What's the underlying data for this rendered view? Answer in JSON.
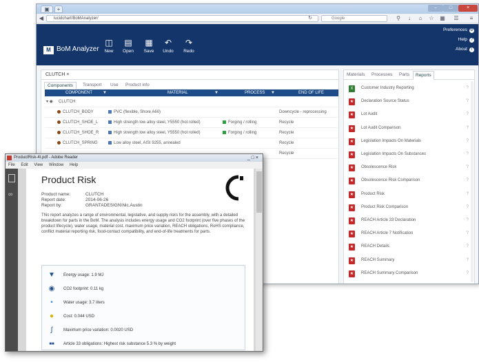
{
  "browser": {
    "url": "lucidchart/BoMAnalyzer/",
    "search_placeholder": "Google",
    "tab_new": "+"
  },
  "app": {
    "logo": "M",
    "name": "BoM Analyzer",
    "toolbar": [
      {
        "label": "New",
        "icon": "new-icon"
      },
      {
        "label": "Open",
        "icon": "open-icon"
      },
      {
        "label": "Save",
        "icon": "save-icon"
      },
      {
        "label": "Undo",
        "icon": "undo-icon"
      },
      {
        "label": "Redo",
        "icon": "redo-icon"
      }
    ],
    "right_links": {
      "preferences": "Preferences",
      "help": "Help",
      "about": "About"
    }
  },
  "left": {
    "doc_tab": "CLUTCH ×",
    "subtabs": [
      "Components",
      "Transport",
      "Use",
      "Product info"
    ],
    "columns": [
      "COMPONENT",
      "MATERIAL",
      "PROCESS",
      "END OF LIFE"
    ],
    "group": "CLUTCH",
    "rows": [
      {
        "component": "CLUTCH_BODY",
        "material": "PVC (flexible, Shore A60)",
        "process": "",
        "eol": "Downcycle - reprocessing"
      },
      {
        "component": "CLUTCH_SHOE_L",
        "material": "High strength low alloy steel, Y5550 (hot rolled)",
        "process": "Forging / rolling",
        "eol": "Recycle"
      },
      {
        "component": "CLUTCH_SHOE_R",
        "material": "High strength low alloy steel, Y5550 (hot rolled)",
        "process": "Forging / rolling",
        "eol": "Recycle"
      },
      {
        "component": "CLUTCH_SPRING",
        "material": "Low alloy steel, AISI 9255, annealed",
        "process": "",
        "eol": "Recycle"
      },
      {
        "component": "",
        "material": "",
        "process": "",
        "eol": "Recycle"
      }
    ]
  },
  "right": {
    "tabs": [
      "Materials",
      "Processes",
      "Parts",
      "Reports"
    ],
    "reports": [
      {
        "label": "Customer Industry Reporting",
        "type": "xls"
      },
      {
        "label": "Declaration Source Status",
        "type": "pdf"
      },
      {
        "label": "Lot Audit",
        "type": "pdf"
      },
      {
        "label": "Lot Audit Comparison",
        "type": "pdf"
      },
      {
        "label": "Legislation Impacts On Materials",
        "type": "pdf"
      },
      {
        "label": "Legislation Impacts On Substances",
        "type": "pdf"
      },
      {
        "label": "Obsolescence Risk",
        "type": "pdf"
      },
      {
        "label": "Obsolescence Risk Comparison",
        "type": "pdf"
      },
      {
        "label": "Product Risk",
        "type": "pdf"
      },
      {
        "label": "Product Risk Comparison",
        "type": "pdf"
      },
      {
        "label": "REACH Article 33 Declaration",
        "type": "pdf"
      },
      {
        "label": "REACH Article 7 Notification",
        "type": "pdf"
      },
      {
        "label": "REACH Details",
        "type": "pdf"
      },
      {
        "label": "REACH Summary",
        "type": "pdf"
      },
      {
        "label": "REACH Summary Comparison",
        "type": "pdf"
      }
    ],
    "help_glyph": "?"
  },
  "pdf": {
    "window_title": "ProductRisk-4t.pdf - Adobe Reader",
    "menu": [
      "File",
      "Edit",
      "View",
      "Window",
      "Help"
    ],
    "title": "Product Risk",
    "meta": [
      {
        "k": "Product name:",
        "v": "CLUTCH"
      },
      {
        "k": "Report date:",
        "v": "2014-06-26"
      },
      {
        "k": "Report by:",
        "v": "GRANTADESIGN\\Nic.Austin"
      }
    ],
    "body": "This report analyzes a range of environmental, legislative, and supply risks for the assembly, with a detailed breakdown for parts in the BoM. The analysis includes energy usage and CO2 footprint (over five phases of the product lifecycle), water usage, material cost, maximum price variation, REACH obligations, RoHS compliance, conflict material reporting risk, food-contact compatibility, and end-of-life treatments for parts.",
    "metrics": [
      {
        "label": "Energy usage: 1.9 MJ",
        "icon": "energy-icon"
      },
      {
        "label": "CO2 footprint: 0.11 kg",
        "icon": "footprint-icon"
      },
      {
        "label": "Water usage: 3.7 liters",
        "icon": "water-icon"
      },
      {
        "label": "Cost: 0.044 USD",
        "icon": "coin-icon"
      },
      {
        "label": "Maximum price variation: 0.0020 USD",
        "icon": "price-variation-icon"
      },
      {
        "label": "Article 33 obligations: Highest risk substance 5.3 % by weight",
        "icon": "reach-icon"
      }
    ],
    "win_controls": "_ □ ×"
  }
}
